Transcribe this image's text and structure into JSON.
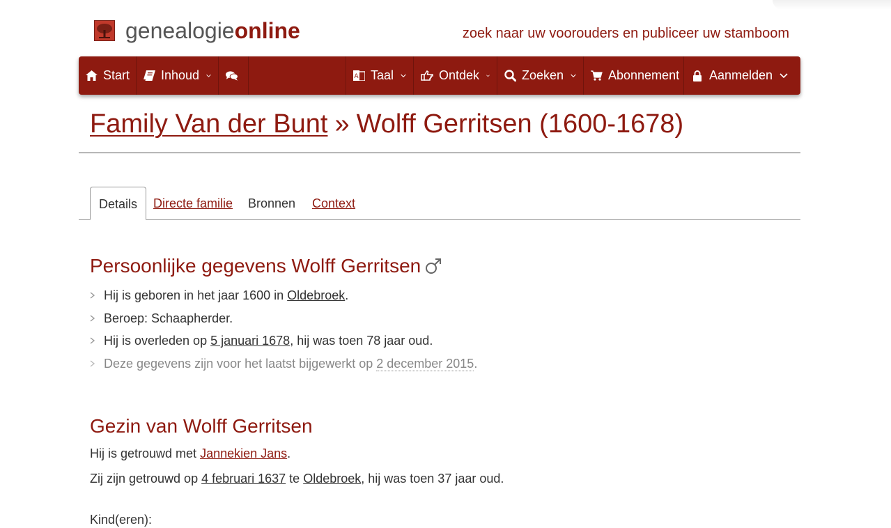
{
  "header": {
    "brand_regular": "genealogie",
    "brand_bold": "online",
    "tagline": "zoek naar uw voorouders en publiceer uw stamboom"
  },
  "nav": {
    "start": "Start",
    "inhoud": "Inhoud",
    "taal": "Taal",
    "ontdek": "Ontdek",
    "zoeken": "Zoeken",
    "abonnement": "Abonnement",
    "aanmelden": "Aanmelden"
  },
  "title": {
    "family_link": "Family Van der Bunt",
    "separator": "»",
    "person": "Wolff Gerritsen (1600-1678)"
  },
  "tabs": [
    "Details",
    "Directe familie",
    "Bronnen",
    "Context"
  ],
  "personal": {
    "heading": "Persoonlijke gegevens Wolff Gerritsen",
    "birth_prefix": "Hij is geboren in het jaar 1600 in ",
    "birth_place": "Oldebroek",
    "birth_suffix": ".",
    "occupation": "Beroep: Schaapherder.",
    "death_prefix": "Hij is overleden op ",
    "death_date": "5 januari 1678",
    "death_suffix": ", hij was toen 78 jaar oud.",
    "updated_prefix": "Deze gegevens zijn voor het laatst bijgewerkt op ",
    "updated_date": "2 december 2015",
    "updated_suffix": "."
  },
  "family": {
    "heading": "Gezin van Wolff Gerritsen",
    "married_prefix": "Hij is getrouwd met ",
    "spouse": "Jannekien Jans",
    "married_suffix": ".",
    "wedding_prefix": "Zij zijn getrouwd op ",
    "wedding_date": "4 februari 1637",
    "wedding_mid": " te ",
    "wedding_place": "Oldebroek",
    "wedding_suffix": ", hij was toen 37 jaar oud.",
    "children_label": "Kind(eren):"
  }
}
